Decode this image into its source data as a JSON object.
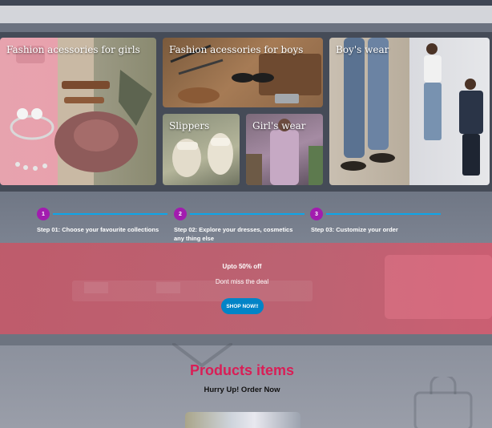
{
  "gallery": {
    "tiles": [
      {
        "label": "Fashion acessories for girls"
      },
      {
        "label": "Fashion acessories for boys"
      },
      {
        "label": "Slippers"
      },
      {
        "label": "Girl's wear"
      },
      {
        "label": "Boy's wear"
      }
    ]
  },
  "steps": [
    {
      "number": "1",
      "text": "Step 01: Choose your favourite collections"
    },
    {
      "number": "2",
      "text": "Step 02: Explore your dresses, cosmetics any thing else"
    },
    {
      "number": "3",
      "text": "Step 03: Customize your order"
    }
  ],
  "promo": {
    "title": "Upto 50% off",
    "subtitle": "Dont miss the deal",
    "button": "SHOP NOW!!"
  },
  "products": {
    "title": "Products items",
    "subtitle": "Hurry Up! Order Now"
  },
  "colors": {
    "accent_title": "#d91e56",
    "step_dot": "#a21caf",
    "step_line": "#0ea5e9",
    "button": "#0284c7",
    "promo_band": "#c45868"
  },
  "icons": [
    "hanger-icon",
    "shopping-bag-icon"
  ]
}
